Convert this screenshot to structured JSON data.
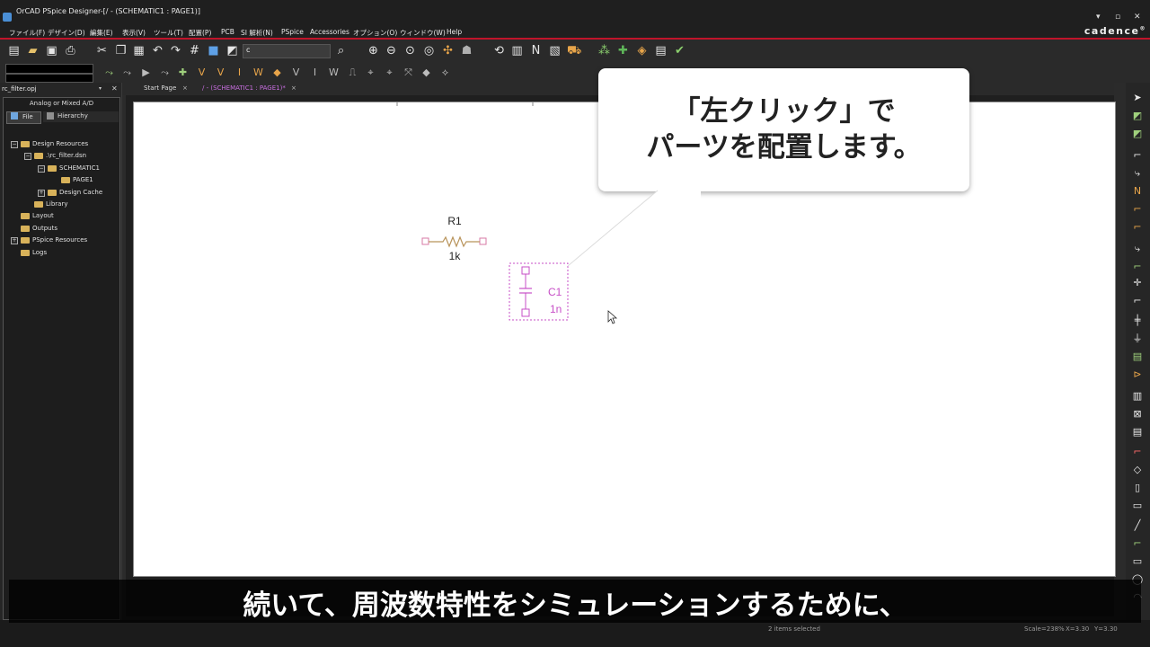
{
  "window": {
    "title": "OrCAD PSpice Designer-[/ - (SCHEMATIC1 : PAGE1)]",
    "min": "▾",
    "restore": "▫",
    "close": "✕"
  },
  "menu": [
    "ファイル(F)",
    "デザイン(D)",
    "編集(E)",
    "表示(V)",
    "ツール(T)",
    "配置(P)",
    "PCB",
    "SI 解析(N)",
    "PSpice",
    "Accessories",
    "オプション(O)",
    "ウィンドウ(W)",
    "Help"
  ],
  "brand": "cadence",
  "brand_mark": "®",
  "toolbar": {
    "part_search_value": "c"
  },
  "project_panel": {
    "title": "rc_filter.opj",
    "drop": "▾",
    "close": "✕",
    "mode": "Analog or Mixed A/D",
    "tab_file": "File",
    "tab_hierarchy": "Hierarchy",
    "tree": [
      {
        "label": "Design Resources",
        "level": 0,
        "expander": "−"
      },
      {
        "label": ".\\rc_filter.dsn",
        "level": 1,
        "expander": "−"
      },
      {
        "label": "SCHEMATIC1",
        "level": 2,
        "expander": "−"
      },
      {
        "label": "PAGE1",
        "level": 3,
        "expander": ""
      },
      {
        "label": "Design Cache",
        "level": 2,
        "expander": "+"
      },
      {
        "label": "Library",
        "level": 1,
        "expander": ""
      },
      {
        "label": "Layout",
        "level": 0,
        "expander": ""
      },
      {
        "label": "Outputs",
        "level": 0,
        "expander": ""
      },
      {
        "label": "PSpice Resources",
        "level": 0,
        "expander": "+"
      },
      {
        "label": "Logs",
        "level": 0,
        "expander": ""
      }
    ]
  },
  "doc_tabs": {
    "start_page": "Start Page",
    "schematic": "/ - (SCHEMATIC1 : PAGE1)*",
    "close": "×"
  },
  "schematic": {
    "resistor": {
      "ref": "R1",
      "value": "1k"
    },
    "capacitor": {
      "ref": "C1",
      "value": "1n"
    },
    "colors": {
      "resistor": "#b8935a",
      "capacitor": "#c74fc7",
      "pin": "#d77aa6"
    }
  },
  "callout": {
    "line1": "「左クリック」で",
    "line2": "パーツを配置します。"
  },
  "subtitle": "続いて、周波数特性をシミュレーションするために、",
  "status": {
    "selection": "2 items selected",
    "scale": "Scale=238%",
    "x": "X=3.30",
    "y": "Y=3.30"
  }
}
